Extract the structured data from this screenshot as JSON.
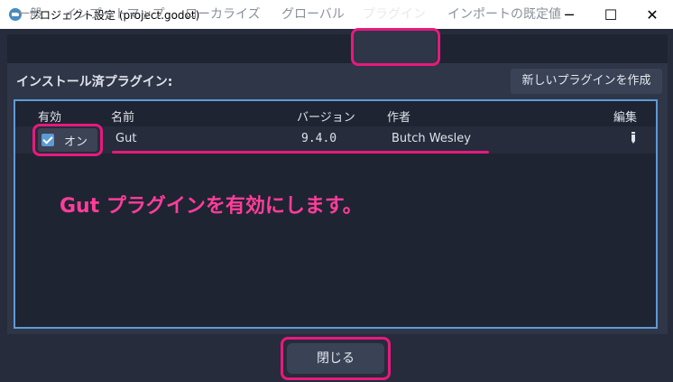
{
  "window": {
    "title": "プロジェクト設定 (project.godot)",
    "minimize_glyph": "─",
    "maximize_glyph": "☐",
    "close_glyph": "✕"
  },
  "tabs": [
    {
      "label": "一般"
    },
    {
      "label": "インプットマップ"
    },
    {
      "label": "ローカライズ"
    },
    {
      "label": "グローバル"
    },
    {
      "label": "プラグイン",
      "active": true
    },
    {
      "label": "インポートの既定値"
    }
  ],
  "plugins": {
    "section_title": "インストール済プラグイン:",
    "create_button": "新しいプラグインを作成",
    "columns": {
      "enabled": "有効",
      "name": "名前",
      "version": "バージョン",
      "author": "作者",
      "edit": "編集"
    },
    "rows": [
      {
        "enabled": true,
        "status": "オン",
        "name": "Gut",
        "version": "9.4.0",
        "author": "Butch Wesley"
      }
    ]
  },
  "annotation": "Gut プラグインを有効にします。",
  "footer": {
    "close_button": "閉じる"
  },
  "icons": {
    "app": "godot-icon",
    "checkbox": "checkbox-checked-icon",
    "edit": "edit-pencil-icon"
  },
  "colors": {
    "background": "#262c3b",
    "panel": "#2f3648",
    "tree": "#1f2432",
    "accent": "#5d9bd6",
    "highlight": "#e8197e",
    "annotation": "#ff3d9a"
  }
}
